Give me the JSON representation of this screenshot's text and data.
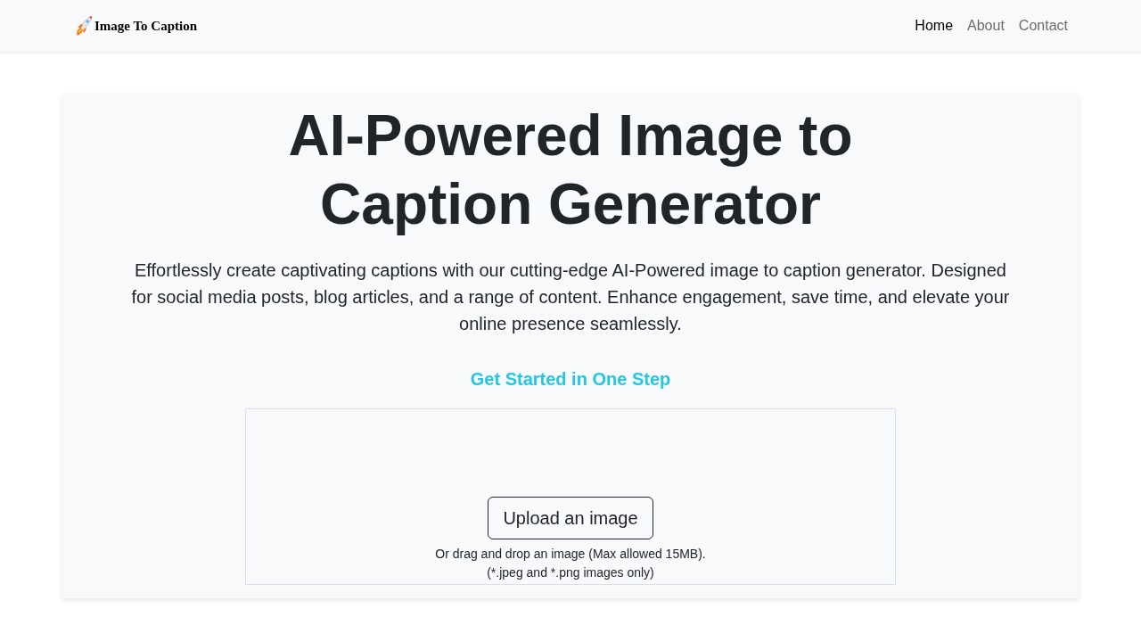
{
  "navbar": {
    "logo": {
      "text": "Image To Caption"
    },
    "links": [
      {
        "label": "Home",
        "selected": true
      },
      {
        "label": "About",
        "selected": false
      },
      {
        "label": "Contact",
        "selected": false
      }
    ]
  },
  "hero": {
    "title": "AI-Powered Image to Caption Generator",
    "description": "Effortlessly create captivating captions with our cutting-edge AI-Powered image to caption generator. Designed for social media posts, blog articles, and a range of content. Enhance engagement, save time, and elevate your online presence seamlessly.",
    "cta_heading": "Get Started in One Step",
    "upload": {
      "button": "Upload an image",
      "hints": [
        "Or drag and drop an image (Max allowed 15MB).",
        "(*.jpeg and *.png images only)"
      ]
    }
  }
}
